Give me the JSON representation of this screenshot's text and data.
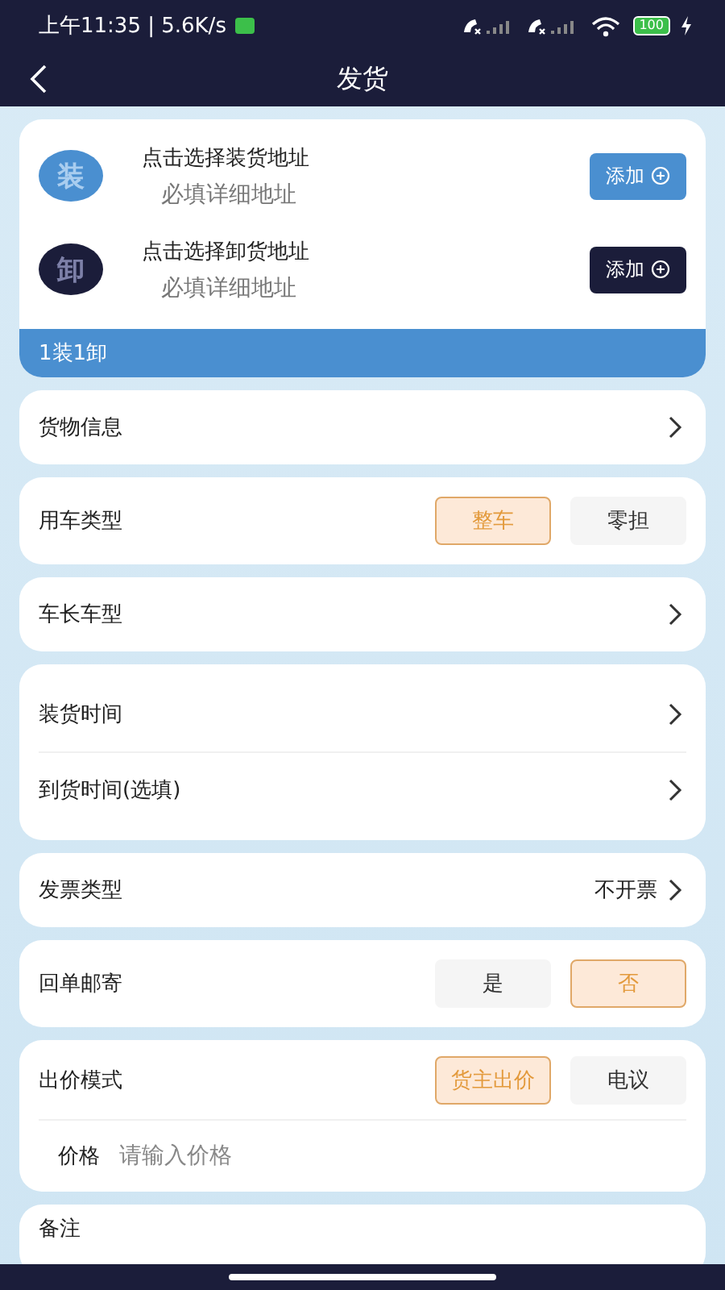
{
  "status_bar": {
    "time": "上午11:35 | 5.6K/s",
    "battery": "100"
  },
  "header": {
    "title": "发货"
  },
  "addresses": [
    {
      "kind": "load",
      "badge": "装",
      "title": "点击选择装货地址",
      "subtitle": "必填详细地址",
      "button": "添加"
    },
    {
      "kind": "unload",
      "badge": "卸",
      "title": "点击选择卸货地址",
      "subtitle": "必填详细地址",
      "button": "添加"
    }
  ],
  "route_summary": "1装1卸",
  "sections": [
    {
      "kind": "nav",
      "rows": [
        {
          "label": "货物信息"
        }
      ]
    },
    {
      "kind": "choice",
      "label": "用车类型",
      "options": [
        {
          "label": "整车",
          "selected": true
        },
        {
          "label": "零担",
          "selected": false
        }
      ]
    },
    {
      "kind": "nav",
      "rows": [
        {
          "label": "车长车型"
        }
      ]
    },
    {
      "kind": "nav",
      "rows": [
        {
          "label": "装货时间"
        },
        {
          "label": "到货时间(选填)"
        }
      ]
    },
    {
      "kind": "nav",
      "rows": [
        {
          "label": "发票类型",
          "value": "不开票"
        }
      ]
    },
    {
      "kind": "choice",
      "label": "回单邮寄",
      "options": [
        {
          "label": "是",
          "selected": false
        },
        {
          "label": "否",
          "selected": true
        }
      ]
    },
    {
      "kind": "choice",
      "label": "出价模式",
      "options": [
        {
          "label": "货主出价",
          "selected": true
        },
        {
          "label": "电议",
          "selected": false
        }
      ],
      "field": {
        "label": "价格",
        "placeholder": "请输入价格"
      }
    },
    {
      "kind": "note",
      "label": "备注"
    }
  ]
}
